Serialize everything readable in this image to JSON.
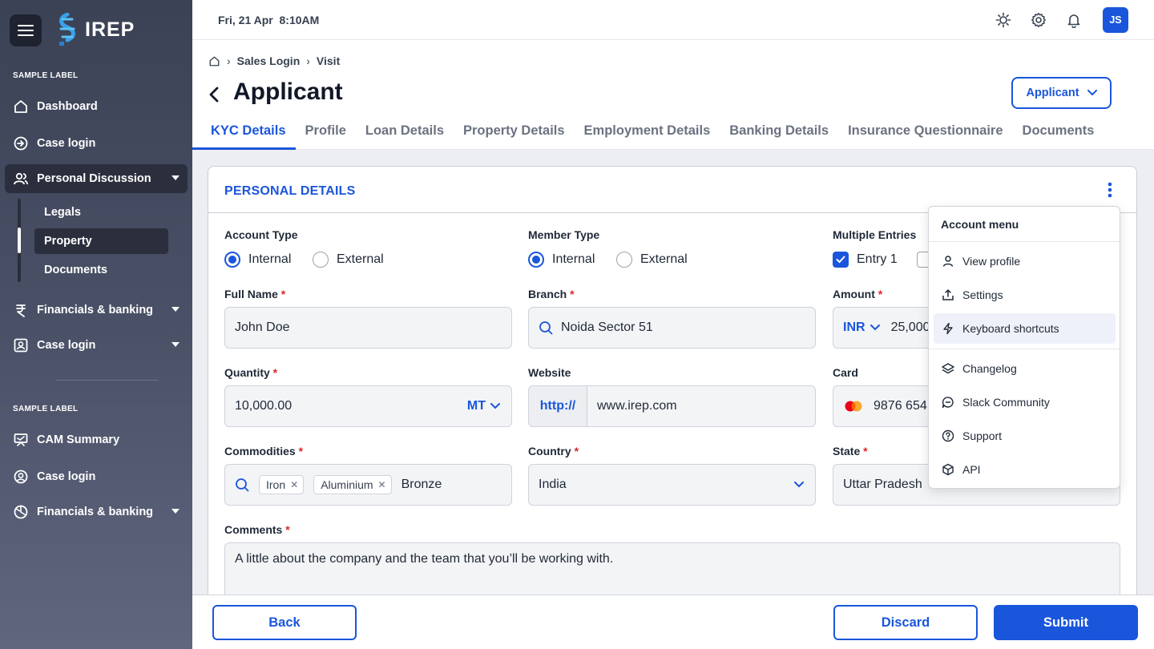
{
  "app": {
    "logo_text": "IREP"
  },
  "sidebar": {
    "section1_label": "SAMPLE LABEL",
    "section2_label": "SAMPLE LABEL",
    "items": [
      {
        "label": "Dashboard",
        "icon": "home-icon"
      },
      {
        "label": "Case login",
        "icon": "login-icon"
      },
      {
        "label": "Personal Discussion",
        "icon": "users-icon"
      },
      {
        "label": "Financials & banking",
        "icon": "rupee-icon"
      },
      {
        "label": "Case login",
        "icon": "id-card-icon"
      },
      {
        "label": "CAM Summary",
        "icon": "presentation-icon"
      },
      {
        "label": "Case login",
        "icon": "user-circle-icon"
      },
      {
        "label": "Financials & banking",
        "icon": "globe-icon"
      }
    ],
    "subitems": [
      {
        "label": "Legals"
      },
      {
        "label": "Property"
      },
      {
        "label": "Documents"
      }
    ]
  },
  "topbar": {
    "datetime": "Fri, 21 Apr  8:10AM",
    "avatar_initials": "JS"
  },
  "breadcrumb": [
    "Sales Login",
    "Visit"
  ],
  "page": {
    "title": "Applicant",
    "selector_label": "Applicant"
  },
  "tabs": [
    {
      "label": "KYC Details",
      "active": true
    },
    {
      "label": "Profile"
    },
    {
      "label": "Loan Details"
    },
    {
      "label": "Property Details"
    },
    {
      "label": "Employment Details"
    },
    {
      "label": "Banking Details"
    },
    {
      "label": "Insurance Questionnaire"
    },
    {
      "label": "Documents"
    }
  ],
  "form": {
    "section_title": "PERSONAL DETAILS",
    "account_type": {
      "label": "Account Type",
      "options": [
        "Internal",
        "External"
      ],
      "selected": "Internal"
    },
    "member_type": {
      "label": "Member Type",
      "options": [
        "Internal",
        "External"
      ],
      "selected": "Internal"
    },
    "multiple_entries": {
      "label": "Multiple Entries",
      "entry1": "Entry 1",
      "entry1_checked": true
    },
    "full_name": {
      "label": "Full Name",
      "required": "*",
      "value": "John Doe"
    },
    "branch": {
      "label": "Branch",
      "required": "*",
      "value": "Noida Sector 51"
    },
    "amount": {
      "label": "Amount",
      "required": "*",
      "currency": "INR",
      "value": "25,000"
    },
    "quantity": {
      "label": "Quantity",
      "required": "*",
      "value": "10,000.00",
      "unit": "MT"
    },
    "website": {
      "label": "Website",
      "prefix": "http://",
      "value": "www.irep.com"
    },
    "card": {
      "label": "Card",
      "value": "9876 654"
    },
    "commodities": {
      "label": "Commodities",
      "required": "*",
      "chips": [
        "Iron",
        "Aluminium"
      ],
      "typed": "Bronze"
    },
    "country": {
      "label": "Country",
      "required": "*",
      "value": "India"
    },
    "state": {
      "label": "State",
      "required": "*",
      "value": "Uttar Pradesh"
    },
    "comments": {
      "label": "Comments",
      "required": "*",
      "value": "A little about the company and the team that you’ll be working with."
    }
  },
  "account_menu": {
    "title": "Account menu",
    "items": [
      {
        "label": "View profile",
        "icon": "user-icon"
      },
      {
        "label": "Settings",
        "icon": "share-icon"
      },
      {
        "label": "Keyboard shortcuts",
        "icon": "lightning-icon",
        "highlighted": true
      },
      {
        "label": "Changelog",
        "icon": "layers-icon"
      },
      {
        "label": "Slack Community",
        "icon": "chat-icon"
      },
      {
        "label": "Support",
        "icon": "help-circle-icon"
      },
      {
        "label": "API",
        "icon": "cube-icon"
      }
    ]
  },
  "footer": {
    "back_label": "Back",
    "discard_label": "Discard",
    "submit_label": "Submit"
  },
  "colors": {
    "accent": "#1a56db",
    "sidebar_top": "#3b4255",
    "sidebar_bottom": "#60667e",
    "required": "#dc2626"
  }
}
